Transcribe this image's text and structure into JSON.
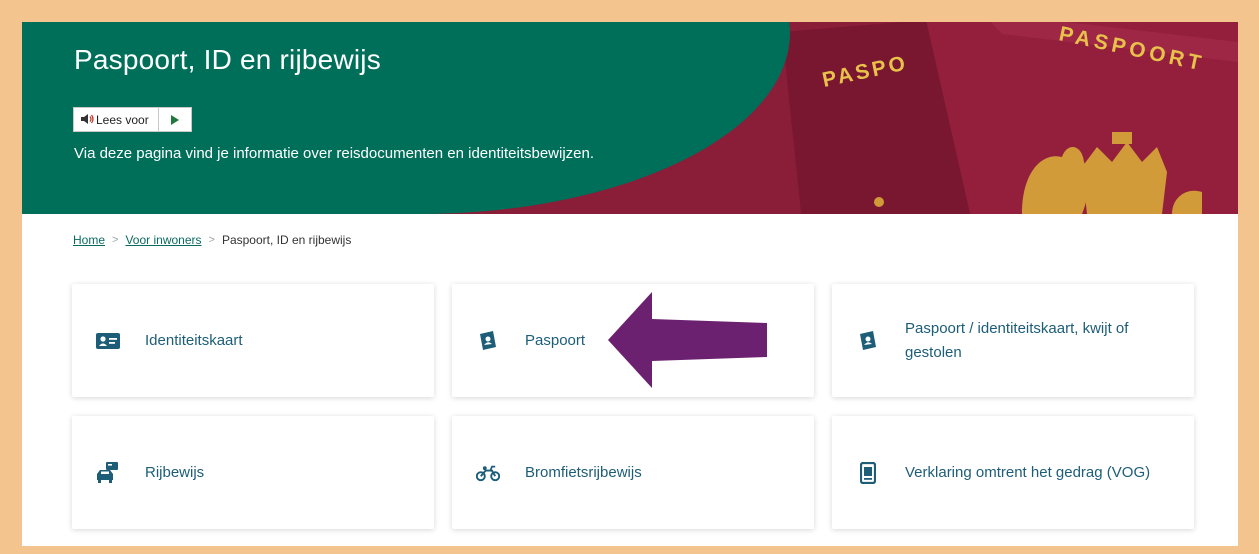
{
  "hero": {
    "title": "Paspoort, ID en rijbewijs",
    "read_aloud_label": "Lees voor",
    "intro": "Via deze pagina vind je informatie over reisdocumenten en identiteitsbewijzen.",
    "passport_text_1": "PASPO",
    "passport_text_2": "PASPOORT"
  },
  "breadcrumb": {
    "items": [
      "Home",
      "Voor inwoners",
      "Paspoort, ID en rijbewijs"
    ],
    "separator": ">"
  },
  "cards": [
    {
      "label": "Identiteitskaart",
      "icon": "id-card-icon"
    },
    {
      "label": "Paspoort",
      "icon": "passport-icon"
    },
    {
      "label": "Paspoort / identiteitskaart, kwijt of gestolen",
      "icon": "passport-lost-icon"
    },
    {
      "label": "Rijbewijs",
      "icon": "car-icon"
    },
    {
      "label": "Bromfietsrijbewijs",
      "icon": "moped-icon"
    },
    {
      "label": "Verklaring omtrent het gedrag (VOG)",
      "icon": "document-icon"
    }
  ],
  "annotation": {
    "arrow_color": "#6b2170",
    "points_to": "Paspoort"
  },
  "colors": {
    "hero_green": "#006f5a",
    "passport_red": "#8e1f3a",
    "link_teal": "#0a6a60",
    "card_text": "#1d5d78",
    "frame_border": "#f4c48f"
  }
}
